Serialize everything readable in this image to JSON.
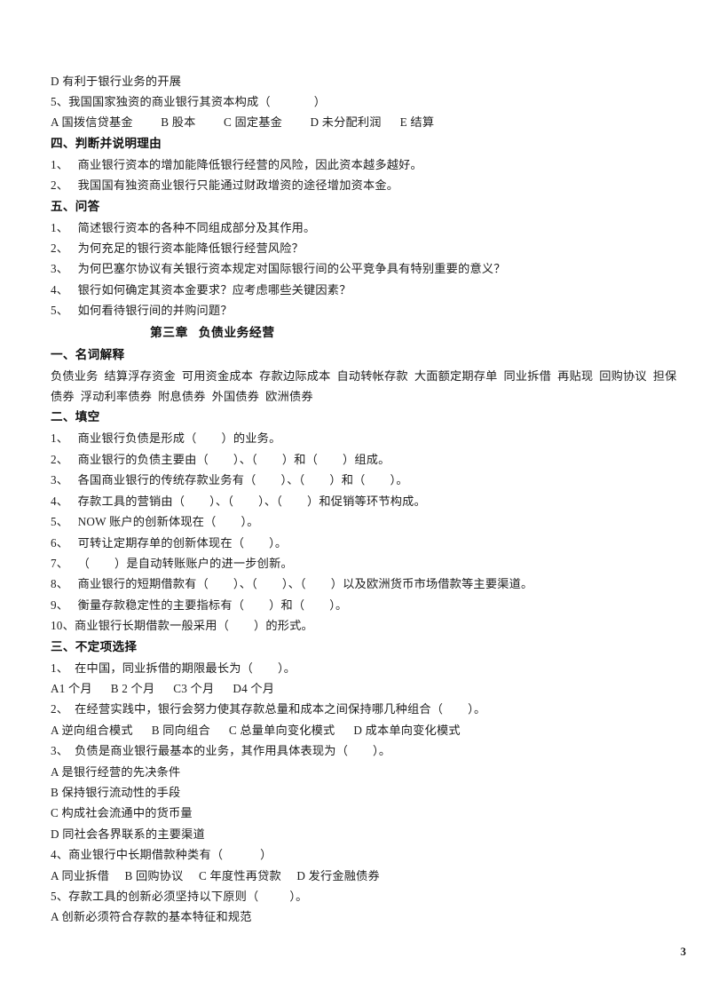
{
  "document": {
    "page_number": "3",
    "text_color": "#1d1d1d"
  },
  "carryover_block": {
    "option_d": "D 有利于银行业务的开展",
    "question_5": "5、我国国家独资的商业银行其资本构成（              ）",
    "question_5_options": "A 国拨信贷基金         B 股本         C 固定基金         D 未分配利润      E 结算"
  },
  "section_four": {
    "heading": "四、判断并说明理由",
    "items": [
      "1、   商业银行资本的增加能降低银行经营的风险，因此资本越多越好。",
      "2、   我国国有独资商业银行只能通过财政增资的途径增加资本金。"
    ]
  },
  "section_five": {
    "heading": "五、问答",
    "items": [
      "1、   简述银行资本的各种不同组成部分及其作用。",
      "2、   为何充足的银行资本能降低银行经营风险？",
      "3、   为何巴塞尔协议有关银行资本规定对国际银行间的公平竞争具有特别重要的意义？",
      "4、   银行如何确定其资本金要求？应考虑哪些关键因素？",
      "5、   如何看待银行间的并购问题？"
    ]
  },
  "chapter": {
    "title": "第三章   负债业务经营"
  },
  "vocabulary": {
    "heading": "一、名词解释",
    "lines": [
      "负债业务  结算浮存资金  可用资金成本  存款边际成本  自动转帐存款  大面额定期存单  同业拆借  再贴现  回购协议  担保",
      "债券  浮动利率债券  附息债券  外国债券  欧洲债券"
    ],
    "terms": [
      "负债业务",
      "结算浮存资金",
      "可用资金成本",
      "存款边际成本",
      "自动转帐存款",
      "大面额定期存单",
      "同业拆借",
      "再贴现",
      "回购协议",
      "担保债券",
      "浮动利率债券",
      "附息债券",
      "外国债券",
      "欧洲债券"
    ]
  },
  "fill_in_blank": {
    "heading": "二、填空",
    "items": [
      "1、   商业银行负债是形成（        ）的业务。",
      "2、   商业银行的负债主要由（        ）、（        ）和（        ）组成。",
      "3、   各国商业银行的传统存款业务有（        ）、（        ）和（        ）。",
      "4、   存款工具的营销由（        ）、（        ）、（        ）和促销等环节构成。",
      "5、   NOW 账户的创新体现在（        ）。",
      "6、   可转让定期存单的创新体现在（        ）。",
      "7、   （        ）是自动转账账户的进一步创新。",
      "8、   商业银行的短期借款有（        ）、（        ）、（        ）以及欧洲货币市场借款等主要渠道。",
      "9、   衡量存款稳定性的主要指标有（        ）和（        ）。",
      "10、商业银行长期借款一般采用（        ）的形式。"
    ]
  },
  "multiple_choice": {
    "heading": "三、不定项选择",
    "questions": [
      {
        "stem": "1、  在中国，同业拆借的期限最长为（        ）。",
        "options_inline": "A1 个月      B 2 个月      C3 个月      D4 个月",
        "options": [
          "A1 个月",
          "B 2 个月",
          "C3 个月",
          "D4 个月"
        ]
      },
      {
        "stem": "2、  在经营实践中，银行会努力使其存款总量和成本之间保持哪几种组合（        ）。",
        "options_inline": "A 逆向组合模式      B 同向组合      C 总量单向变化模式      D 成本单向变化模式",
        "options": [
          "A 逆向组合模式",
          "B 同向组合",
          "C 总量单向变化模式",
          "D 成本单向变化模式"
        ]
      },
      {
        "stem": "3、  负债是商业银行最基本的业务，其作用具体表现为（        ）。",
        "options_stacked": [
          "A 是银行经营的先决条件",
          "B 保持银行流动性的手段",
          "C 构成社会流通中的货币量",
          "D 同社会各界联系的主要渠道"
        ]
      },
      {
        "stem": "4、商业银行中长期借款种类有（            ）",
        "options_inline": "A 同业拆借     B 回购协议     C 年度性再贷款     D 发行金融债券",
        "options": [
          "A 同业拆借",
          "B 回购协议",
          "C 年度性再贷款",
          "D 发行金融债券"
        ]
      },
      {
        "stem": "5、存款工具的创新必须坚持以下原则（          ）。",
        "options_stacked": [
          "A 创新必须符合存款的基本特征和规范"
        ]
      }
    ]
  }
}
